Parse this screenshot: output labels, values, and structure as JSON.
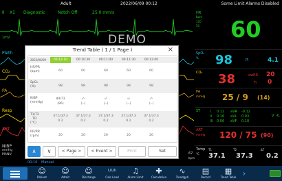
{
  "topbar": {
    "patient_type": "Adult",
    "datetime": "2022/06/09 00:12",
    "alarm_status": "Some Limit Alarms Disabled"
  },
  "ecg": {
    "lead": "II",
    "lead2": "X1",
    "mode": "Diagnostic",
    "notch": "Notch Off",
    "speed": "25.0 mm/s",
    "scale": "1mV",
    "hr_label": "HR",
    "hr_unit": "bpm",
    "hr_hi": "120",
    "hr_lo": "50",
    "hr_value": "60"
  },
  "demo_label": "DEMO",
  "waves": {
    "pleth": "Pleth",
    "co2": "CO₂",
    "pa": "PA",
    "resp": "Resp",
    "art": "ART",
    "nibp": "NIBP",
    "nibp_unit": "mmHg",
    "nibp_sub": "MANU"
  },
  "params": {
    "spo2_label": "SpO₂",
    "spo2_unit": "%",
    "spo2_value": "98",
    "pi_label": "PI",
    "pi_value": "4.1",
    "co2_value": "38",
    "awrr_label": "awRR",
    "awrr_value": "20",
    "fi_label": "Fi",
    "fi_value": "0",
    "pa_label": "PA",
    "pa_unit": "mmHg",
    "pa_value": "25 / 9",
    "pa_mean": "(14)",
    "st_label": "ST",
    "st_rows": [
      {
        "lead": "I",
        "val": "0.11",
        "lead2": "aVR",
        "val2": "-0.12"
      },
      {
        "lead": "II",
        "val": "0.16",
        "lead2": "aVL",
        "val2": "0.03"
      },
      {
        "lead": "III",
        "val": "0.06",
        "lead2": "aVF",
        "val2": "0.10"
      }
    ],
    "v_label": "V",
    "v_value": "-0.",
    "art_label": "ART",
    "art_unit": "mmHg",
    "art_value": "120 / 75",
    "art_mean": "(90)",
    "temp_label": "Temp",
    "temp_unit": "°C",
    "t1_label": "T1",
    "t1_value": "37.1",
    "t2_label": "T2",
    "t2_value": "37.3",
    "dt_label": "ΔT",
    "dt_value": "0.2",
    "nibp_time": "00:10",
    "nibp_mode": "Manual",
    "nibp_side_value": "67",
    "nibp_side_unit": "bpm"
  },
  "dialog": {
    "title": "Trend Table ( 1 / 1 Page )",
    "close": "×",
    "times": [
      "2022/06/09",
      "00:12:10",
      "00:10:30",
      "00:11:00",
      "00:11:30",
      "00:12:00"
    ],
    "rows": [
      {
        "name": "HR/PR",
        "unit": "(bpm)",
        "values": [
          "60",
          "60",
          "60",
          "60",
          "60"
        ]
      },
      {
        "name": "SpO₂",
        "unit": "(%)",
        "values": [
          "98",
          "98",
          "98",
          "98",
          "98"
        ]
      },
      {
        "name": "NIBP",
        "unit": "(mmHg)",
        "values": [
          "89/73",
          "-/-",
          "-/-",
          "-/-",
          "-/-"
        ],
        "sub": [
          "(86)",
          "(--)",
          "(--)",
          "(--)",
          "(--)"
        ]
      },
      {
        "name": "T1/T2",
        "unit": "TD",
        "unit2": "(°C)",
        "values": [
          "37.1/37.3",
          "37.1/37.3",
          "37.1/37.3",
          "37.1/37.3",
          "37.1/37.3"
        ],
        "sub": [
          "0.2",
          "0.2",
          "0.2",
          "0.2",
          "0.2"
        ]
      },
      {
        "name": "RR/RR",
        "unit": "(rpm)",
        "values": [
          "20",
          "20",
          "20",
          "20",
          "20"
        ]
      }
    ],
    "buttons": {
      "up": "∧",
      "down": "∨",
      "page": "< Page >",
      "event": "< Event >",
      "print": "Print",
      "set": "Set"
    }
  },
  "toolbar": {
    "items": [
      {
        "icon": "☺",
        "label": "Patient"
      },
      {
        "icon": "☺",
        "label": "Admit"
      },
      {
        "icon": "☺",
        "label": "Discharge"
      },
      {
        "icon": "I,II,III",
        "label": "Calc Lead"
      },
      {
        "icon": "♫",
        "label": "Alarm Limit"
      },
      {
        "icon": "✚",
        "label": "Calculation"
      },
      {
        "icon": "∿",
        "label": "Trendgph"
      },
      {
        "icon": "▤",
        "label": "Record"
      },
      {
        "icon": "▦",
        "label": "Trend Table"
      }
    ],
    "next": "›"
  },
  "colors": {
    "ecg": "#22cc22",
    "spo2": "#19c4d9",
    "co2": "#ffd800",
    "pa": "#d6a020",
    "resp": "#ffd800",
    "art": "#e53030",
    "nibp": "#d0d0d0",
    "temp": "#dcdcdc"
  }
}
